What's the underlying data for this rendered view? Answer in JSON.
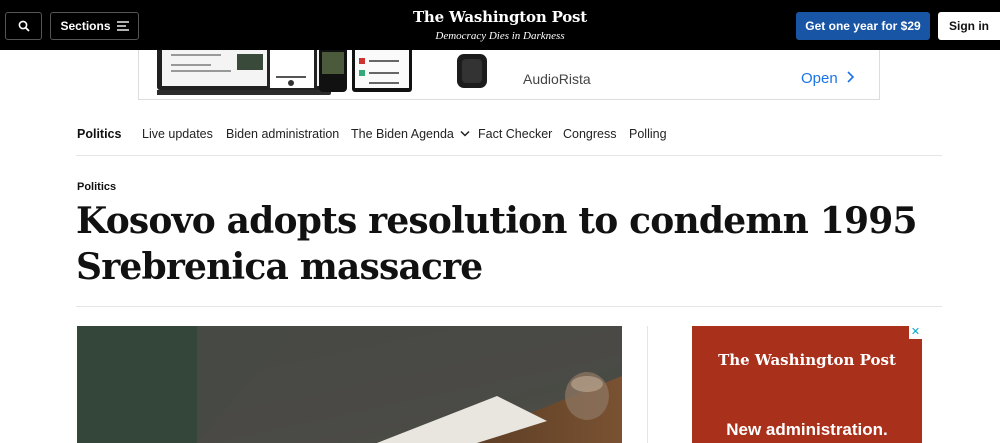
{
  "header": {
    "sections_label": "Sections",
    "brand": "The Washington Post",
    "tagline": "Democracy Dies in Darkness",
    "subscribe_label": "Get one year for $29",
    "signin_label": "Sign in"
  },
  "top_ad": {
    "app_name": "AudioRista",
    "open_label": "Open"
  },
  "nav": {
    "items": [
      "Politics",
      "Live updates",
      "Biden administration",
      "The Biden Agenda",
      "Fact Checker",
      "Congress",
      "Polling"
    ]
  },
  "article": {
    "kicker": "Politics",
    "headline": "Kosovo adopts resolution to condemn 1995 Srebrenica massacre"
  },
  "side_ad": {
    "brand": "The Washington Post",
    "cta": "New administration.",
    "close_glyph": "✕"
  },
  "colors": {
    "topbar": "#000000",
    "subscribe": "#1955a5",
    "ad_bg": "#a9301a",
    "open_link": "#1a73e8"
  },
  "icons": [
    "search-icon",
    "menu-icon",
    "chevron-right-icon",
    "chevron-down-icon",
    "close-icon"
  ]
}
